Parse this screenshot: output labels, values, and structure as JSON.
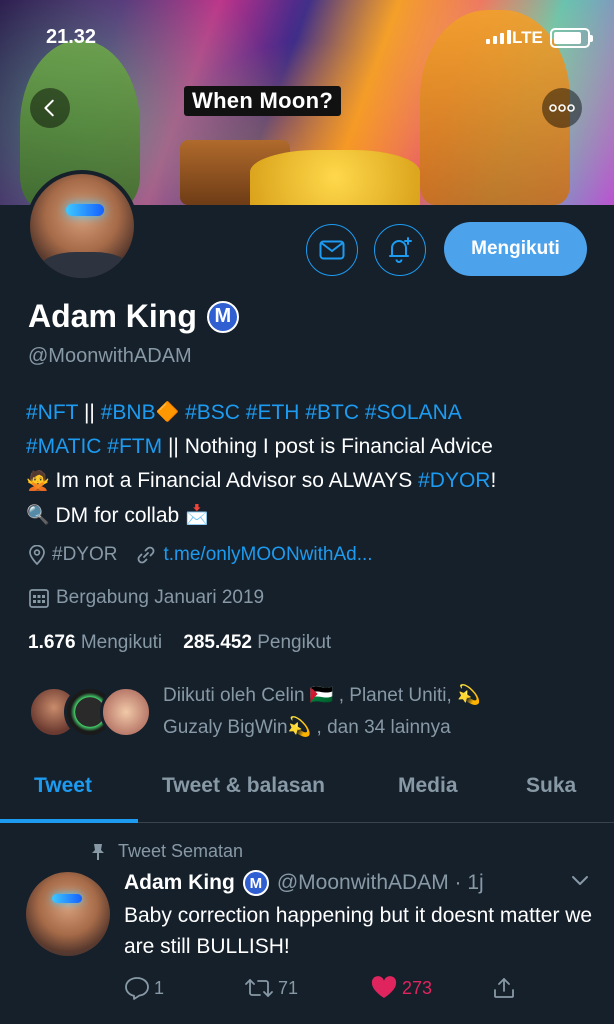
{
  "status_bar": {
    "time": "21.32",
    "network": "LTE",
    "battery_level": 0.85
  },
  "banner": {
    "caption": "When Moon?"
  },
  "profile": {
    "name": "Adam King",
    "badge": "M",
    "handle": "@MoonwithADAM",
    "bio": {
      "line1": [
        {
          "text": "#NFT",
          "tag": true
        },
        {
          "text": " || ",
          "tag": false
        },
        {
          "text": "#BNB",
          "tag": true
        },
        {
          "text": "🔶",
          "emoji": true
        },
        {
          "text": " ",
          "tag": false
        },
        {
          "text": "#BSC",
          "tag": true
        },
        {
          "text": " ",
          "tag": false
        },
        {
          "text": "#ETH",
          "tag": true
        },
        {
          "text": " ",
          "tag": false
        },
        {
          "text": "#BTC",
          "tag": true
        },
        {
          "text": " ",
          "tag": false
        },
        {
          "text": "#SOLANA",
          "tag": true
        }
      ],
      "line2": [
        {
          "text": "#MATIC",
          "tag": true
        },
        {
          "text": " ",
          "tag": false
        },
        {
          "text": "#FTM",
          "tag": true
        },
        {
          "text": " || Nothing I post is Financial Advice",
          "tag": false
        }
      ],
      "line3": [
        {
          "text": "🙅",
          "emoji": true
        },
        {
          "text": " Im not a Financial Advisor so ALWAYS ",
          "tag": false
        },
        {
          "text": "#DYOR",
          "tag": true
        },
        {
          "text": "!",
          "tag": false
        }
      ],
      "line4": [
        {
          "text": "🔍",
          "emoji": true
        },
        {
          "text": " DM for collab ",
          "tag": false
        },
        {
          "text": "📩",
          "emoji": true
        }
      ]
    },
    "location": "#DYOR",
    "website": "t.me/onlyMOONwithAd...",
    "joined": "Bergabung Januari 2019",
    "following_count": "1.676",
    "following_label": "Mengikuti",
    "followers_count": "285.452",
    "followers_label": "Pengikut",
    "followed_by_line1": "Diikuti oleh Celin 🇵🇸 , Planet Uniti, 💫",
    "followed_by_line2": "Guzaly BigWin💫 , dan 34 lainnya",
    "follow_button": "Mengikuti"
  },
  "tabs": [
    {
      "label": "Tweet",
      "active": true
    },
    {
      "label": "Tweet & balasan",
      "active": false
    },
    {
      "label": "Media",
      "active": false
    },
    {
      "label": "Suka",
      "active": false
    }
  ],
  "tweet": {
    "pinned_label": "Tweet Sematan",
    "name": "Adam King",
    "badge": "M",
    "handle_time": "@MoonwithADAM · 1j",
    "text": "Baby correction happening but it doesnt matter we are still BULLISH!",
    "replies": "1",
    "retweets": "71",
    "likes": "273",
    "liked": true
  },
  "colors": {
    "background": "#15202b",
    "accent": "#1d9bf0",
    "muted": "#8899a6",
    "like": "#e0245e",
    "follow_button": "#4ca3ec"
  }
}
